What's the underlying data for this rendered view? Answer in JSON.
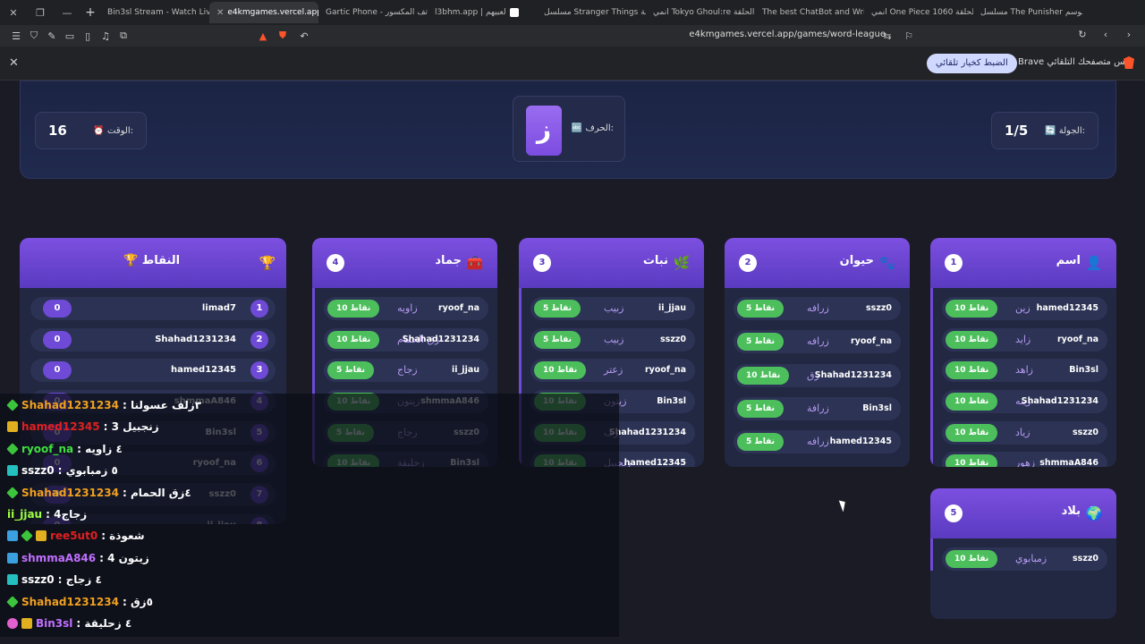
{
  "browser": {
    "tabs": [
      {
        "label": "Bin3sl Stream - Watch Live",
        "color": "#53fc18"
      },
      {
        "label": "e4kmgames.vercel.app",
        "color": "#ffffff",
        "active": true
      },
      {
        "label": "Gartic Phone - لعبة الهاتف المكسور",
        "color": "#c08ad8"
      },
      {
        "label": "l3bhm.app | لعبيهم",
        "color": "#ffffff"
      },
      {
        "label": "مسلسل Stranger Things الحلقة",
        "color": "#e50914"
      },
      {
        "label": "انمي Tokyo Ghoul:re الحلقة",
        "color": "#2bc0d8"
      },
      {
        "label": "The best ChatBot and Writing",
        "color": "#ffffff"
      },
      {
        "label": "انمي One Piece الحلقة 1060",
        "color": "#2bc0d8"
      },
      {
        "label": "مسلسل The Punisher الموسم",
        "color": "#e50914"
      }
    ],
    "address": "e4kmgames.vercel.app/games/word-league",
    "infobar_button": "الضبط كخيار تلقائي",
    "infobar_text": "Brave ليس متصفحك التلقائي."
  },
  "header": {
    "round_label": "الجولة:",
    "round_value": "1/5",
    "letter_label": "الحرف:",
    "letter": "ز",
    "time_label": "الوقت:",
    "time_value": "16"
  },
  "categories": [
    {
      "num": "1",
      "title": "اسم",
      "icon": "👤",
      "rows": [
        {
          "user": "hamed12345",
          "word": "زين",
          "points": "10 نقاط"
        },
        {
          "user": "ryoof_na",
          "word": "زايد",
          "points": "10 نقاط"
        },
        {
          "user": "Bin3sl",
          "word": "زاهد",
          "points": "10 نقاط"
        },
        {
          "user": "Shahad1231234",
          "word": "زينه",
          "points": "10 نقاط"
        },
        {
          "user": "sszz0",
          "word": "زياد",
          "points": "10 نقاط"
        },
        {
          "user": "shmmaA846",
          "word": "زهور",
          "points": "10 نقاط"
        }
      ]
    },
    {
      "num": "2",
      "title": "حيوان",
      "icon": "🐾",
      "rows": [
        {
          "user": "sszz0",
          "word": "زرافه",
          "points": "5 نقاط"
        },
        {
          "user": "ryoof_na",
          "word": "زرافه",
          "points": "5 نقاط"
        },
        {
          "user": "Shahad1231234",
          "word": "زق",
          "points": "10 نقاط"
        },
        {
          "user": "Bin3sl",
          "word": "زرافة",
          "points": "5 نقاط"
        },
        {
          "user": "hamed12345",
          "word": "زرافه",
          "points": "5 نقاط"
        }
      ]
    },
    {
      "num": "3",
      "title": "نبات",
      "icon": "🌿",
      "rows": [
        {
          "user": "ii_jjau",
          "word": "زبيب",
          "points": "5 نقاط"
        },
        {
          "user": "sszz0",
          "word": "زبيب",
          "points": "5 نقاط"
        },
        {
          "user": "ryoof_na",
          "word": "زعتر",
          "points": "10 نقاط"
        },
        {
          "user": "Bin3sl",
          "word": "زيتون",
          "points": "10 نقاط"
        },
        {
          "user": "Shahad1231234",
          "word": "زف",
          "points": "10 نقاط"
        },
        {
          "user": "hamed12345",
          "word": "زنجبيل",
          "points": "10 نقاط"
        }
      ]
    },
    {
      "num": "4",
      "title": "جماد",
      "icon": "🧰",
      "rows": [
        {
          "user": "ryoof_na",
          "word": "زاويه",
          "points": "10 نقاط"
        },
        {
          "user": "Shahad1231234",
          "word": "زق الحمام",
          "points": "10 نقاط"
        },
        {
          "user": "ii_jjau",
          "word": "زجاج",
          "points": "5 نقاط"
        },
        {
          "user": "shmmaA846",
          "word": "زيتون",
          "points": "10 نقاط"
        },
        {
          "user": "sszz0",
          "word": "زجاج",
          "points": "5 نقاط"
        },
        {
          "user": "Bin3sl",
          "word": "زحليقة",
          "points": "10 نقاط"
        }
      ]
    },
    {
      "num": "5",
      "title": "بلاد",
      "icon": "🌍",
      "rows": [
        {
          "user": "sszz0",
          "word": "زمبابوي",
          "points": "10 نقاط"
        }
      ]
    }
  ],
  "scoreboard": {
    "title": "🏆 النقاط",
    "rows": [
      {
        "rank": "1",
        "name": "limad7",
        "pts": "0"
      },
      {
        "rank": "2",
        "name": "Shahad1231234",
        "pts": "0"
      },
      {
        "rank": "3",
        "name": "hamed12345",
        "pts": "0"
      },
      {
        "rank": "4",
        "name": "shmmaA846",
        "pts": "0"
      },
      {
        "rank": "5",
        "name": "Bin3sl",
        "pts": "0"
      },
      {
        "rank": "6",
        "name": "ryoof_na",
        "pts": "0"
      },
      {
        "rank": "7",
        "name": "sszz0",
        "pts": "0"
      },
      {
        "rank": "8",
        "name": "ii_jjau",
        "pts": "0"
      }
    ]
  },
  "chat": [
    {
      "user": "Shahad1231234",
      "color": "#f0a020",
      "msg": ": ٣زلف عسولنا",
      "icons": [
        "green"
      ]
    },
    {
      "user": "hamed12345",
      "color": "#e02020",
      "msg": ": زنجبيل 3",
      "icons": [
        "gold"
      ]
    },
    {
      "user": "ryoof_na",
      "color": "#40e040",
      "msg": ": ٤ زاويه",
      "icons": [
        "green"
      ]
    },
    {
      "user": "sszz0",
      "color": "#ffffff",
      "msg": ": ٥ زمبابوي",
      "icons": [
        "cyan"
      ]
    },
    {
      "user": "Shahad1231234",
      "color": "#f0a020",
      "msg": ": ٤زق الحمام",
      "icons": [
        "green"
      ]
    },
    {
      "user": "ii_jjau",
      "color": "#a0ff40",
      "msg": ": زجاج4",
      "icons": []
    },
    {
      "user": "ree5ut0",
      "color": "#e02020",
      "msg": ": شعوذة",
      "icons": [
        "blue",
        "green",
        "gold"
      ]
    },
    {
      "user": "shmmaA846",
      "color": "#c070ff",
      "msg": ": زيتون 4",
      "icons": [
        "blue"
      ]
    },
    {
      "user": "sszz0",
      "color": "#ffffff",
      "msg": ": ٤ زجاج",
      "icons": [
        "cyan"
      ]
    },
    {
      "user": "Shahad1231234",
      "color": "#f0a020",
      "msg": ": ٥زق",
      "icons": [
        "green"
      ]
    },
    {
      "user": "Bin3sl",
      "color": "#c070ff",
      "msg": ": ٤ زحليقة",
      "icons": [
        "pink",
        "gold"
      ]
    }
  ]
}
